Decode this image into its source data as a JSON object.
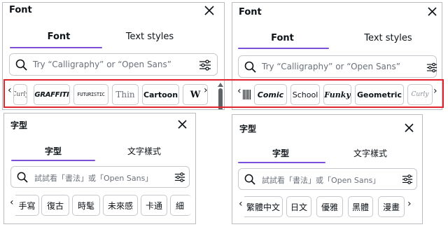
{
  "panels": {
    "en_left": {
      "title": "Font",
      "tabs": [
        "Font",
        "Text styles"
      ],
      "search_placeholder": "Try “Calligraphy” or “Open Sans”",
      "chips": [
        "Curly",
        "GRAFFITI",
        "FUTURISTIC",
        "Thin",
        "Cartoon",
        "W"
      ]
    },
    "en_right": {
      "title": "Font",
      "tabs": [
        "Font",
        "Text styles"
      ],
      "search_placeholder": "Try “Calligraphy” or “Open Sans”",
      "chips": [
        "Comic",
        "School",
        "Funky",
        "Geometric",
        "Curly"
      ]
    },
    "zh_left": {
      "title": "字型",
      "tabs": [
        "字型",
        "文字樣式"
      ],
      "search_placeholder": "試試看「書法」或「Open Sans」",
      "chips": [
        "手寫",
        "復古",
        "時髦",
        "未來感",
        "卡通",
        "細"
      ]
    },
    "zh_right": {
      "title": "字型",
      "tabs": [
        "字型",
        "文字樣式"
      ],
      "search_placeholder": "試試看「書法」或「Open Sans」",
      "chips": [
        "繁體中文",
        "日文",
        "優雅",
        "黑體",
        "漫畫"
      ]
    }
  },
  "colors": {
    "accent": "#7b4fd8",
    "highlight": "#e0262c",
    "border": "#b9bcc1"
  }
}
